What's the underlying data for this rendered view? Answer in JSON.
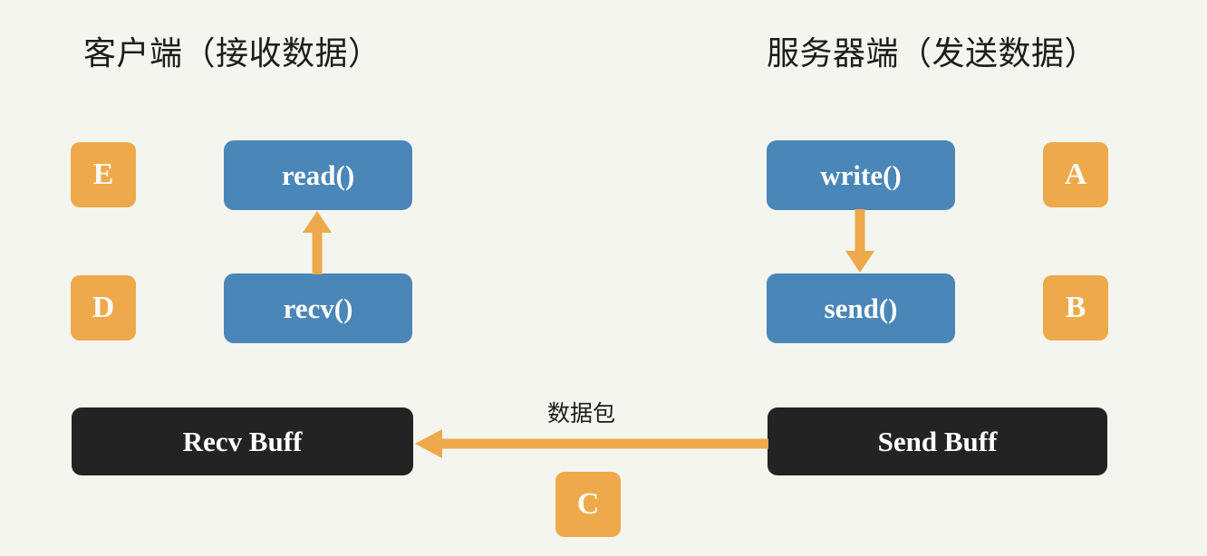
{
  "diagram": {
    "background_color": "#f3f5ee",
    "accent_orange": "#eda94a",
    "accent_blue": "#4a86b8",
    "accent_black": "#232323"
  },
  "titles": {
    "client": "客户端（接收数据）",
    "server": "服务器端（发送数据）"
  },
  "badges": {
    "a": "A",
    "b": "B",
    "c": "C",
    "d": "D",
    "e": "E"
  },
  "functions": {
    "read": "read()",
    "recv": "recv()",
    "write": "write()",
    "send": "send()"
  },
  "buffers": {
    "recv": "Recv Buff",
    "send": "Send Buff"
  },
  "labels": {
    "packet": "数据包"
  },
  "arrows": {
    "recv_to_read": "up-arrow-icon",
    "write_to_send": "down-arrow-icon",
    "send_to_recv": "left-arrow-icon"
  }
}
